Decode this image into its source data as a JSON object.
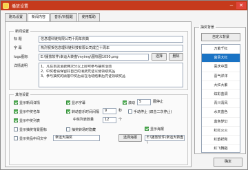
{
  "window": {
    "title": "播放设置"
  },
  "tabs": [
    "跑马设置",
    "新闻内容",
    "音乐/铃提醒",
    "使用帮助"
  ],
  "news": {
    "group_title": "新闻设置",
    "title_label": "标    题",
    "title_value": "信息理科链有限公司十周年庆典",
    "subtitle_label": "字    幕",
    "subtitle_value": "热烈祝贺信息理科链科技有限公司成立十周年",
    "logo_label": "logo图标",
    "logo_value": "E:\\播放软件\\幸运大转盘\\myimg\\图标图1050.png",
    "select_label": "选择",
    "delete_label": "删除",
    "detail_label": "详情说明",
    "detail_lines": [
      "1、凡在本店消费两次分以上即可参与抽奖活动",
      "2、中奖者请保留好自己的消费凭证以便领取奖品",
      "3、参与抽奖的顾客中奖后请在活动结束后凭证领取奖品"
    ]
  },
  "other": {
    "group_title": "其他设置",
    "show_news_detail": "显示新闻详情",
    "show_subtitle": "显示字幕",
    "scroll_label": "滚动",
    "scroll_value": "5",
    "scroll_unit": "圈停止",
    "show_winners_list": "显示中奖名单",
    "interval_label": "转动音乐时间间隔",
    "interval_value": "9",
    "interval_unit": "秒",
    "manual_stop": "手动停止 (双击二次停止)",
    "show_winning_list": "显示中奖列表",
    "prize_count_label": "中奖列表数量",
    "prize_count_value": "12",
    "prize_count_unit": "个",
    "show_flow_graph": "显示抽奖背景图标",
    "hide_transition": "抽奖转场时隐藏",
    "show_bgmusic": "显示海报",
    "show_center_text": "显示奖品中间文字",
    "center_text_value": "幸运大抽奖",
    "select_poster_label": "选择海报",
    "poster_path": "E:\\播放软件\\幸运大转盘\\"
  },
  "bg": {
    "group_title": "抽奖背景",
    "custom_label": "自定义背景",
    "items": [
      "万紫千红",
      "富贵大红",
      "喜庆中国",
      "喜气洋洋",
      "大红大紫",
      "炫彩蓝调",
      "青川清风",
      "水天蓝色",
      "蓝色梦幻",
      "红红火火",
      "红韵祥和",
      "红飞舞蹈"
    ],
    "selected_index": 1
  },
  "footer": {
    "ok_label": "确定"
  },
  "colors": {
    "titlebar": "#c63a1c",
    "selected": "#1a73c4",
    "checked": "#4caf50"
  }
}
